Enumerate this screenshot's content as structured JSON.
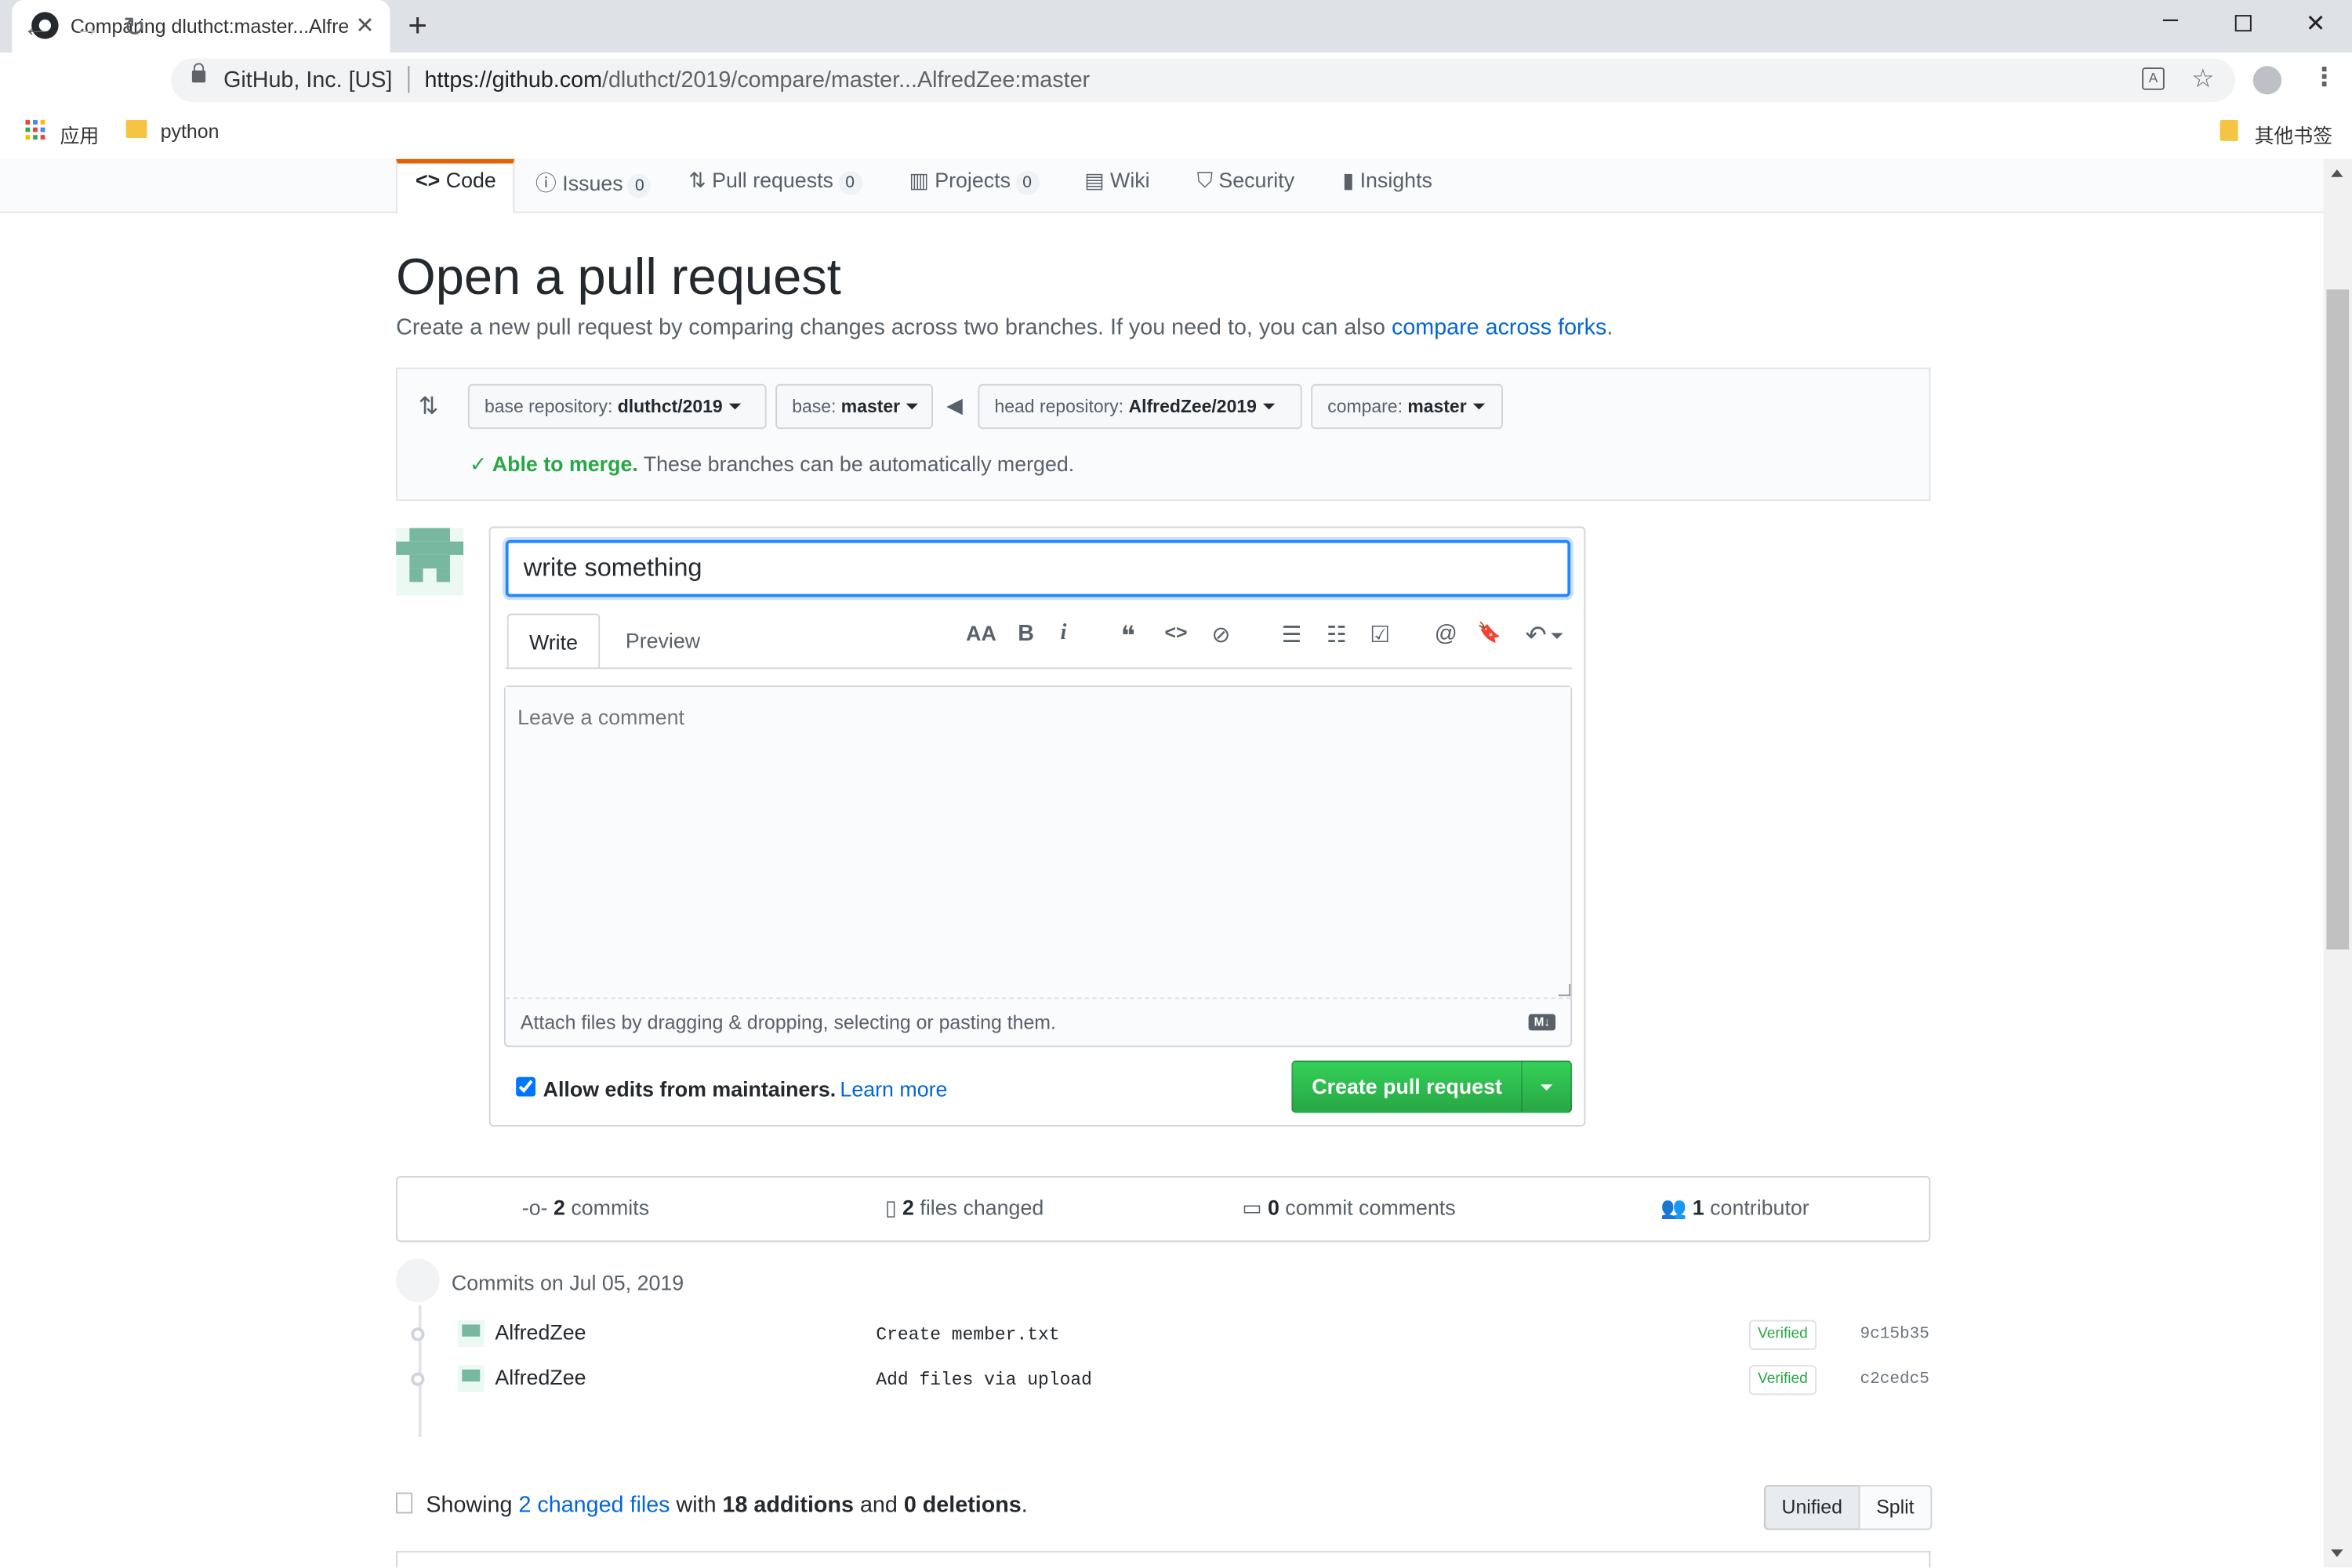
{
  "browser": {
    "tab_title": "Comparing dluthct:master...AlfredZee:master",
    "new_tab": "+",
    "close_tab": "✕",
    "site_identity": "GitHub, Inc. [US]",
    "url_host": "https://github.com",
    "url_path": "/dluthct/2019/compare/master...AlfredZee:master",
    "bookmarks": {
      "apps": "应用",
      "python": "python",
      "other": "其他书签"
    }
  },
  "repo_nav": {
    "code": "Code",
    "issues": "Issues",
    "issues_count": "0",
    "pulls": "Pull requests",
    "pulls_count": "0",
    "projects": "Projects",
    "projects_count": "0",
    "wiki": "Wiki",
    "security": "Security",
    "insights": "Insights"
  },
  "page": {
    "title": "Open a pull request",
    "subtitle": "Create a new pull request by comparing changes across two branches. If you need to, you can also ",
    "subtitle_link": "compare across forks",
    "subtitle_end": "."
  },
  "range": {
    "base_repo_label": "base repository: ",
    "base_repo_value": "dluthct/2019",
    "base_label": "base: ",
    "base_value": "master",
    "head_repo_label": "head repository: ",
    "head_repo_value": "AlfredZee/2019",
    "compare_label": "compare: ",
    "compare_value": "master",
    "merge_ok": "Able to merge.",
    "merge_text": " These branches can be automatically merged."
  },
  "form": {
    "title_value": "write something",
    "tab_write": "Write",
    "tab_preview": "Preview",
    "comment_placeholder": "Leave a comment",
    "attach_text": "Attach files by dragging & dropping, selecting or pasting them.",
    "md_badge": "M↓",
    "allow_edits": "Allow edits from maintainers.",
    "learn_more": "Learn more",
    "submit": "Create pull request",
    "toolbar": [
      "AA",
      "B",
      "i",
      "❝",
      "<>",
      "⊘",
      "☰",
      "☷",
      "☑",
      "@",
      "🔖",
      "↶"
    ]
  },
  "summary": {
    "commits_n": "2",
    "commits": " commits",
    "files_n": "2",
    "files": " files changed",
    "comments_n": "0",
    "comments": " commit comments",
    "contrib_n": "1",
    "contrib": " contributor"
  },
  "commits": {
    "date": "Commits on Jul 05, 2019",
    "items": [
      {
        "author": "AlfredZee",
        "message": "Create member.txt",
        "badge": "Verified",
        "sha": "9c15b35"
      },
      {
        "author": "AlfredZee",
        "message": "Add files via upload",
        "badge": "Verified",
        "sha": "c2cedc5"
      }
    ]
  },
  "diffstat": {
    "prefix": "Showing ",
    "files_link": "2 changed files",
    "mid": " with ",
    "additions": "18 additions",
    "and": " and ",
    "deletions": "0 deletions",
    "end": ".",
    "unified": "Unified",
    "split": "Split"
  },
  "colors": {
    "accent_link": "#0366d6",
    "success": "#28a745",
    "focus": "#2188ff"
  }
}
